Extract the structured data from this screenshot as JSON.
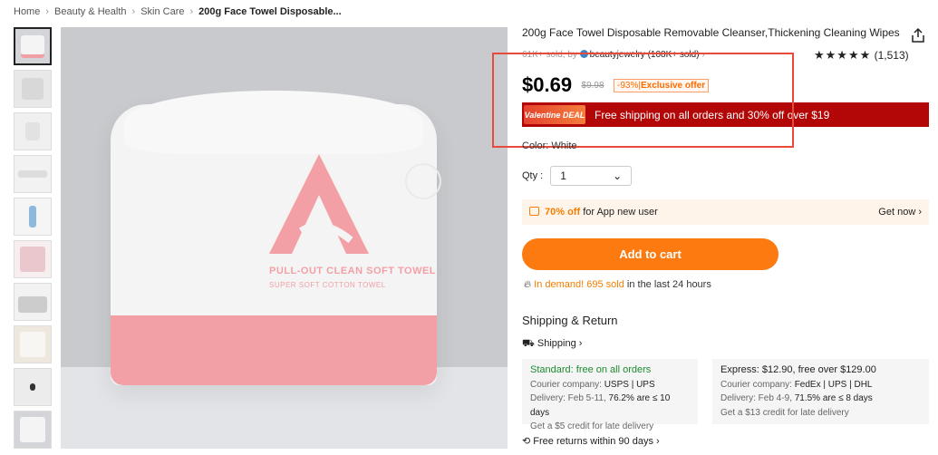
{
  "breadcrumb": {
    "items": [
      "Home",
      "Beauty & Health",
      "Skin Care"
    ],
    "current": "200g Face Towel Disposable..."
  },
  "product": {
    "title": "200g Face Towel Disposable Removable Cleanser,Thickening Cleaning Wipes",
    "sold_text": "61K+ sold, by",
    "store_name": "beautyjewelry (108K+ sold)",
    "rating_stars": "★★★★★",
    "rating_count": "(1,513)",
    "price": "$0.69",
    "old_price": "$9.98",
    "discount": "-93%",
    "discount_label": "Exclusive offer",
    "deal_badge": "Valentine DEAL",
    "deal_text": "Free shipping on all orders and 30% off over $19",
    "color_text": "Color: White",
    "qty_label": "Qty :",
    "qty_value": "1"
  },
  "image": {
    "brand_line1": "PULL-OUT CLEAN SOFT TOWEL",
    "brand_line2": "SUPER SOFT COTTON TOWEL"
  },
  "app_offer": {
    "percent": "70% off",
    "text": "for App new user",
    "cta": "Get now"
  },
  "cart": {
    "label": "Add to cart"
  },
  "demand": {
    "highlight": "In demand! 695 sold",
    "suffix": "in the last 24 hours"
  },
  "shipping": {
    "title": "Shipping & Return",
    "link": "Shipping",
    "standard": {
      "head": "Standard: free on all orders",
      "courier": "Courier company:",
      "couriers": "USPS | UPS",
      "delivery": "Delivery: Feb 5-11,",
      "delivery_pct": "76.2% are ≤ 10 days",
      "credit": "Get a $5 credit for late delivery"
    },
    "express": {
      "head": "Express: $12.90, free over $129.00",
      "courier": "Courier company:",
      "couriers": "FedEx | UPS | DHL",
      "delivery": "Delivery: Feb 4-9,",
      "delivery_pct": "71.5% are ≤ 8 days",
      "credit": "Get a $13 credit for late delivery"
    },
    "returns": "Free returns within 90 days"
  },
  "colors": {
    "accent": "#fd7a10",
    "deal_red": "#b30707",
    "highlight_border": "#e84b3c",
    "pink": "#f2a0a6"
  }
}
